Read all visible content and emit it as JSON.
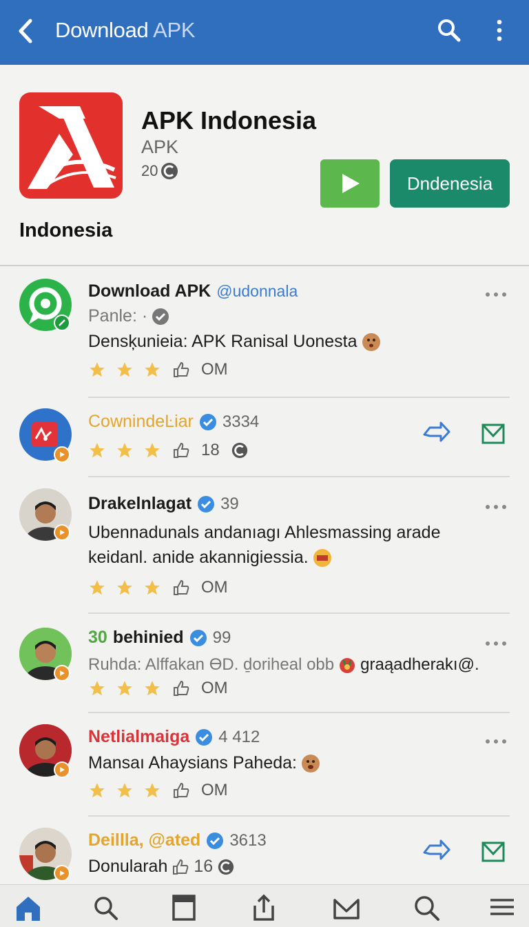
{
  "topbar": {
    "title_main": "Download",
    "title_dim": "APK"
  },
  "app": {
    "name": "APK Indonesia",
    "sub": "APK",
    "count": "20",
    "download_button": "Dndenesia",
    "section_label": "Indonesia"
  },
  "posts": [
    {
      "name": "Download APK",
      "handle": "@udonnala",
      "subline": "Panle: ·",
      "text": "Densķunieia: APK Ranisal Uonesta",
      "count": "OM"
    },
    {
      "name": "CownindeĿiar",
      "number": "3334",
      "count": "18"
    },
    {
      "name": "Drakelnlagat",
      "number": "39",
      "text_line1": "Ubennadunals andanıagı Ahlesmassing arade",
      "text_line2": "keidanl. anide akannigiessia.",
      "count": "OM"
    },
    {
      "name_prefix": "30",
      "name": "behinied",
      "number": "99",
      "subline": "Ruhda: Alffakan ӨD. ḏoriheal obb",
      "subline_tail": "graąadherakı@.",
      "count": "OM"
    },
    {
      "name": "Netlialmaiga",
      "number": "4 412",
      "text": "Mansaı Ahaysians Paheda:",
      "count": "OM"
    },
    {
      "name": "Deillla, @ated",
      "number": "3613",
      "text": "Donularah",
      "count": "16"
    }
  ],
  "colors": {
    "topbar": "#2f6fbe",
    "play": "#5cb84c",
    "download": "#1b8a6a",
    "star": "#f2c04a",
    "verified": "#3b8de0",
    "name_orange": "#e3a52c",
    "name_green": "#4caa3c",
    "name_red": "#d8353a"
  }
}
